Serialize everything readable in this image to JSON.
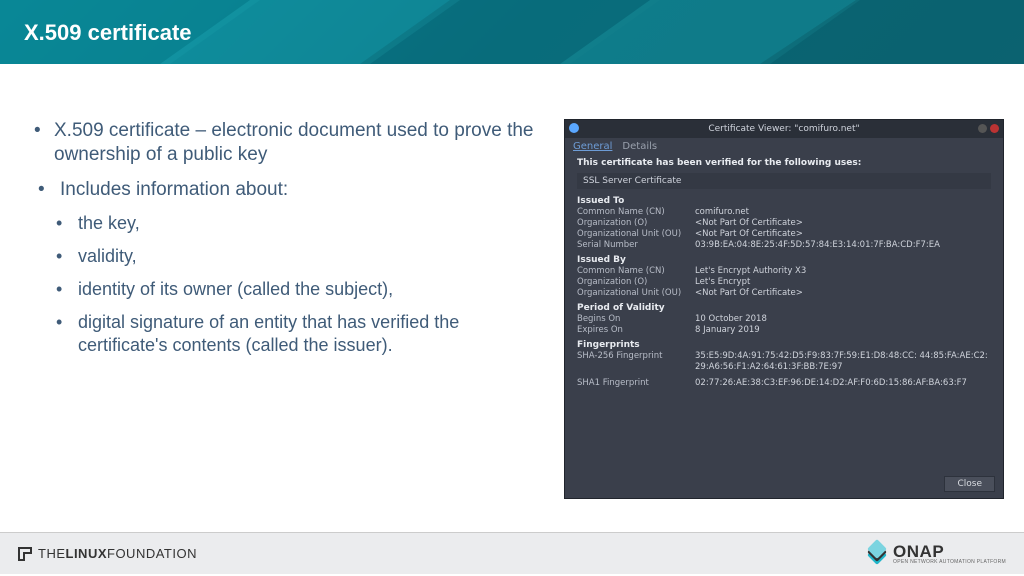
{
  "header": {
    "title": "X.509 certificate"
  },
  "bullets": {
    "main": "X.509 certificate – electronic document used to prove the ownership of a public key",
    "sub1": "Includes information about:",
    "a": "the key,",
    "b": "validity,",
    "c": "identity of its owner (called the subject),",
    "d": "digital signature of an entity that has verified the certificate's contents (called the issuer)."
  },
  "cert": {
    "window_title": "Certificate Viewer: \"comifuro.net\"",
    "tab_general": "General",
    "tab_details": "Details",
    "verified_msg": "This certificate has been verified for the following uses:",
    "use": "SSL Server Certificate",
    "issued_to_h": "Issued To",
    "cn_k": "Common Name (CN)",
    "cn_v": "comifuro.net",
    "o_k": "Organization (O)",
    "o_v": "<Not Part Of Certificate>",
    "ou_k": "Organizational Unit (OU)",
    "ou_v": "<Not Part Of Certificate>",
    "sn_k": "Serial Number",
    "sn_v": "03:9B:EA:04:8E:25:4F:5D:57:84:E3:14:01:7F:BA:CD:F7:EA",
    "issued_by_h": "Issued By",
    "cn2_v": "Let's Encrypt Authority X3",
    "o2_v": "Let's Encrypt",
    "ou2_v": "<Not Part Of Certificate>",
    "validity_h": "Period of Validity",
    "begins_k": "Begins On",
    "begins_v": "10 October 2018",
    "expires_k": "Expires On",
    "expires_v": "8 January 2019",
    "fp_h": "Fingerprints",
    "sha256_k": "SHA-256 Fingerprint",
    "sha256_v": "35:E5:9D:4A:91:75:42:D5:F9:83:7F:59:E1:D8:48:CC: 44:85:FA:AE:C2:29:A6:56:F1:A2:64:61:3F:BB:7E:97",
    "sha1_k": "SHA1 Fingerprint",
    "sha1_v": "02:77:26:AE:38:C3:EF:96:DE:14:D2:AF:F0:6D:15:86:AF:BA:63:F7",
    "close": "Close"
  },
  "footer": {
    "lf_the": "THE",
    "lf_linux": "LINUX",
    "lf_foundation": "FOUNDATION",
    "onap": "ONAP",
    "onap_sub": "OPEN NETWORK AUTOMATION PLATFORM"
  }
}
